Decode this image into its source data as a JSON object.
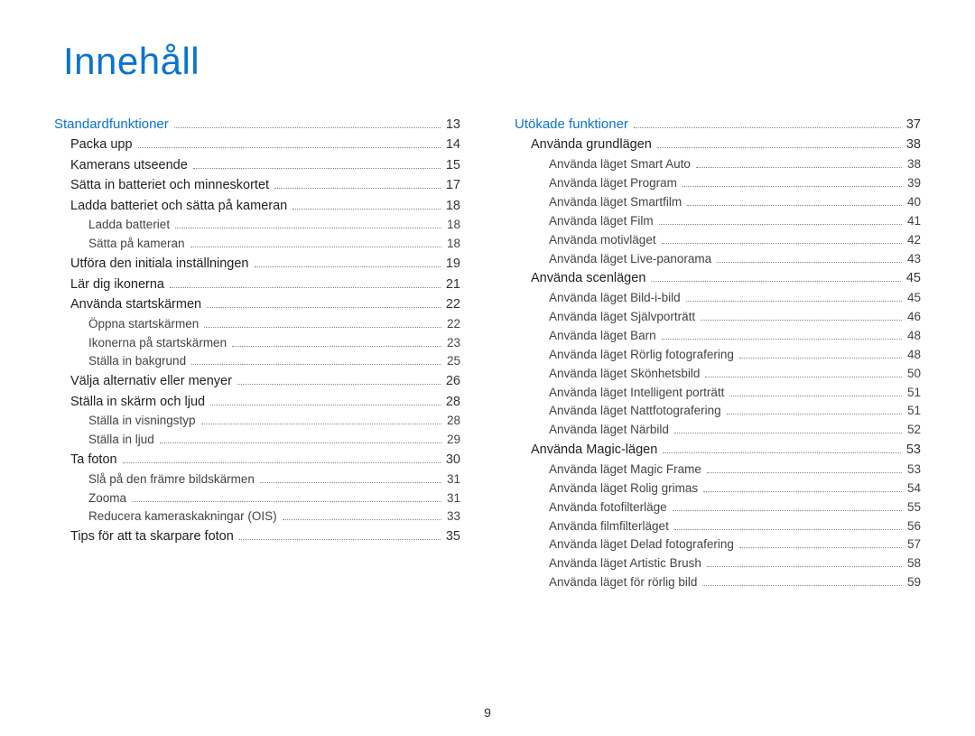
{
  "title": "Innehåll",
  "pageNumber": "9",
  "columns": [
    [
      {
        "level": 0,
        "label": "Standardfunktioner",
        "page": "13"
      },
      {
        "level": 1,
        "label": "Packa upp",
        "page": "14"
      },
      {
        "level": 1,
        "label": "Kamerans utseende",
        "page": "15"
      },
      {
        "level": 1,
        "label": "Sätta in batteriet och minneskortet",
        "page": "17"
      },
      {
        "level": 1,
        "label": "Ladda batteriet och sätta på kameran",
        "page": "18"
      },
      {
        "level": 2,
        "label": "Ladda batteriet",
        "page": "18"
      },
      {
        "level": 2,
        "label": "Sätta på kameran",
        "page": "18"
      },
      {
        "level": 1,
        "label": "Utföra den initiala inställningen",
        "page": "19"
      },
      {
        "level": 1,
        "label": "Lär dig ikonerna",
        "page": "21"
      },
      {
        "level": 1,
        "label": "Använda startskärmen",
        "page": "22"
      },
      {
        "level": 2,
        "label": "Öppna startskärmen",
        "page": "22"
      },
      {
        "level": 2,
        "label": "Ikonerna på startskärmen",
        "page": "23"
      },
      {
        "level": 2,
        "label": "Ställa in bakgrund",
        "page": "25"
      },
      {
        "level": 1,
        "label": "Välja alternativ eller menyer",
        "page": "26"
      },
      {
        "level": 1,
        "label": "Ställa in skärm och ljud",
        "page": "28"
      },
      {
        "level": 2,
        "label": "Ställa in visningstyp",
        "page": "28"
      },
      {
        "level": 2,
        "label": "Ställa in ljud",
        "page": "29"
      },
      {
        "level": 1,
        "label": "Ta foton",
        "page": "30"
      },
      {
        "level": 2,
        "label": "Slå på den främre bildskärmen",
        "page": "31"
      },
      {
        "level": 2,
        "label": "Zooma",
        "page": "31"
      },
      {
        "level": 2,
        "label": "Reducera kameraskakningar (OIS)",
        "page": "33"
      },
      {
        "level": 1,
        "label": "Tips för att ta skarpare foton",
        "page": "35"
      }
    ],
    [
      {
        "level": 0,
        "label": "Utökade funktioner",
        "page": "37"
      },
      {
        "level": 1,
        "label": "Använda grundlägen",
        "page": "38"
      },
      {
        "level": 2,
        "label": "Använda läget Smart Auto",
        "page": "38"
      },
      {
        "level": 2,
        "label": "Använda läget Program",
        "page": "39"
      },
      {
        "level": 2,
        "label": "Använda läget Smartfilm",
        "page": "40"
      },
      {
        "level": 2,
        "label": "Använda läget Film",
        "page": "41"
      },
      {
        "level": 2,
        "label": "Använda motivläget",
        "page": "42"
      },
      {
        "level": 2,
        "label": "Använda läget Live-panorama",
        "page": "43"
      },
      {
        "level": 1,
        "label": "Använda scenlägen",
        "page": "45"
      },
      {
        "level": 2,
        "label": "Använda läget Bild-i-bild",
        "page": "45"
      },
      {
        "level": 2,
        "label": "Använda läget Självporträtt",
        "page": "46"
      },
      {
        "level": 2,
        "label": "Använda läget Barn",
        "page": "48"
      },
      {
        "level": 2,
        "label": "Använda läget Rörlig fotografering",
        "page": "48"
      },
      {
        "level": 2,
        "label": "Använda läget Skönhetsbild",
        "page": "50"
      },
      {
        "level": 2,
        "label": "Använda läget Intelligent porträtt",
        "page": "51"
      },
      {
        "level": 2,
        "label": "Använda läget Nattfotografering",
        "page": "51"
      },
      {
        "level": 2,
        "label": "Använda läget Närbild",
        "page": "52"
      },
      {
        "level": 1,
        "label": "Använda Magic-lägen",
        "page": "53"
      },
      {
        "level": 2,
        "label": "Använda läget Magic Frame",
        "page": "53"
      },
      {
        "level": 2,
        "label": "Använda läget Rolig grimas",
        "page": "54"
      },
      {
        "level": 2,
        "label": "Använda fotofilterläge",
        "page": "55"
      },
      {
        "level": 2,
        "label": "Använda filmfilterläget",
        "page": "56"
      },
      {
        "level": 2,
        "label": "Använda läget Delad fotografering",
        "page": "57"
      },
      {
        "level": 2,
        "label": "Använda läget Artistic Brush",
        "page": "58"
      },
      {
        "level": 2,
        "label": "Använda läget för rörlig bild",
        "page": "59"
      }
    ]
  ]
}
